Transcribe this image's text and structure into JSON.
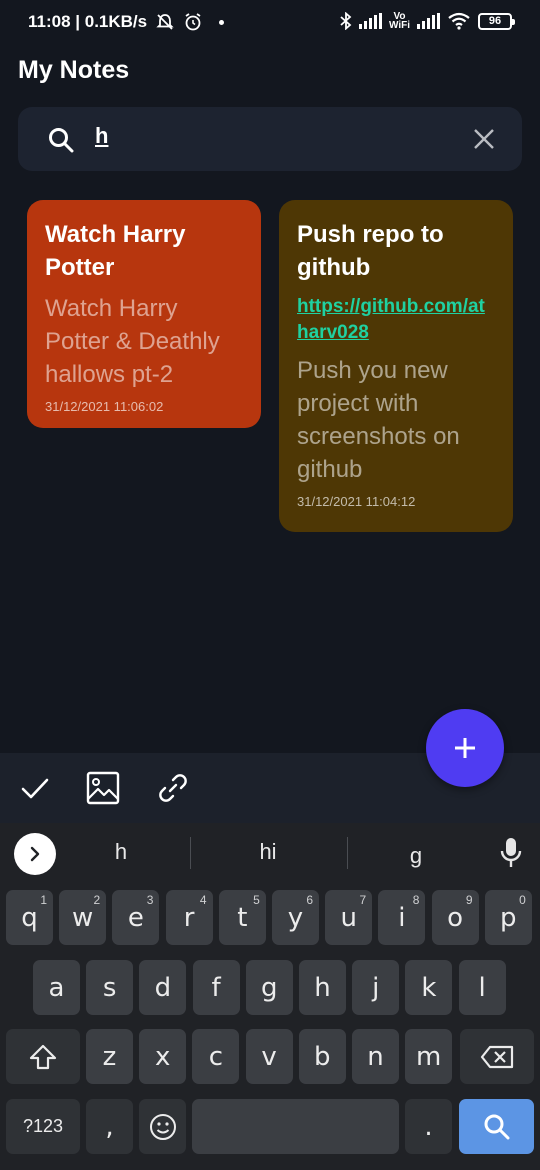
{
  "status_bar": {
    "time_speed": "11:08 | 0.1KB/s",
    "battery": "96",
    "vowifi_top": "Vo",
    "vowifi_bottom": "WiFi"
  },
  "header": {
    "title": "My Notes"
  },
  "search": {
    "value": "h"
  },
  "notes": [
    {
      "title": "Watch Harry Potter",
      "body": "Watch Harry Potter & Deathly hallows pt-2",
      "date": "31/12/2021 11:06:02",
      "color": "#b7360e"
    },
    {
      "title": "Push repo to github",
      "link": "https://github.com/atharv028",
      "body": "Push you new project with screenshots on github",
      "date": "31/12/2021 11:04:12",
      "color": "#4e3705"
    }
  ],
  "fab": {
    "label": "+",
    "color": "#4f3cf2"
  },
  "toolbar": {
    "icons": [
      "check-icon",
      "image-icon",
      "link-icon"
    ]
  },
  "keyboard": {
    "suggestions": [
      "h",
      "hi",
      "g"
    ],
    "row1": [
      {
        "key": "q",
        "hint": "1"
      },
      {
        "key": "w",
        "hint": "2"
      },
      {
        "key": "e",
        "hint": "3"
      },
      {
        "key": "r",
        "hint": "4"
      },
      {
        "key": "t",
        "hint": "5"
      },
      {
        "key": "y",
        "hint": "6"
      },
      {
        "key": "u",
        "hint": "7"
      },
      {
        "key": "i",
        "hint": "8"
      },
      {
        "key": "o",
        "hint": "9"
      },
      {
        "key": "p",
        "hint": "0"
      }
    ],
    "row2": [
      "a",
      "s",
      "d",
      "f",
      "g",
      "h",
      "j",
      "k",
      "l"
    ],
    "row3": [
      "z",
      "x",
      "c",
      "v",
      "b",
      "n",
      "m"
    ],
    "symbols_key": "?123",
    "comma_key": ",",
    "period_key": ".",
    "accent_color": "#5c95e4"
  }
}
